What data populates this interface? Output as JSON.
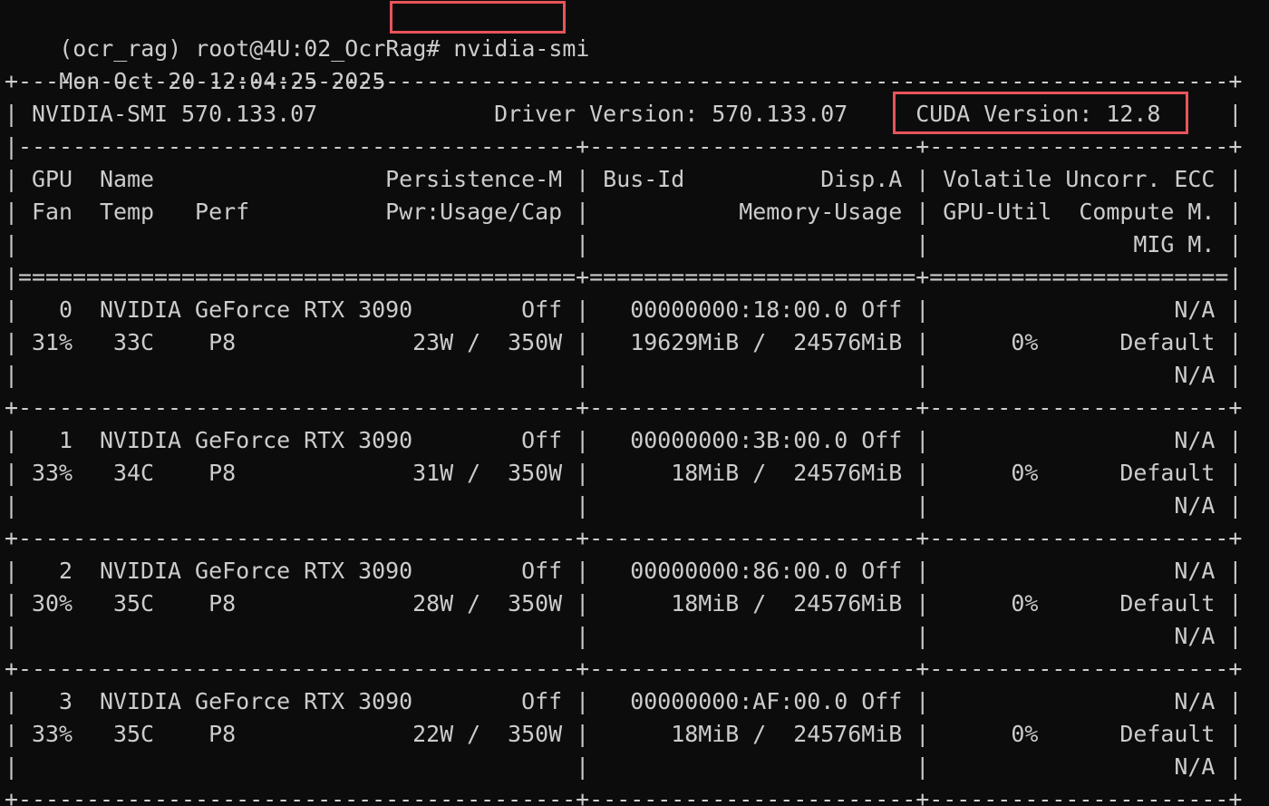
{
  "terminal": {
    "prompt": "(ocr_rag) root@4U:02_OcrRag# ",
    "command": "nvidia-smi",
    "timestamp": "Mon Oct 20 12:04:25 2025"
  },
  "smi": {
    "border_solid": "+-----------------------------------------------------------------------------------------+",
    "header_line": "| NVIDIA-SMI 570.133.07             Driver Version: 570.133.07     CUDA Version: 12.8     |",
    "divider_dashed": "|-----------------------------------------+------------------------+----------------------+",
    "col_header_1": "| GPU  Name                 Persistence-M | Bus-Id          Disp.A | Volatile Uncorr. ECC |",
    "col_header_2": "| Fan  Temp   Perf          Pwr:Usage/Cap |           Memory-Usage | GPU-Util  Compute M. |",
    "col_header_3": "|                                         |                        |               MIG M. |",
    "divider_double": "|=========================================+========================+======================|",
    "row_separator": "+-----------------------------------------+------------------------+----------------------+",
    "gpus": [
      {
        "line1": "|   0  NVIDIA GeForce RTX 3090        Off |   00000000:18:00.0 Off |                  N/A |",
        "line2": "| 31%   33C    P8             23W /  350W |   19629MiB /  24576MiB |      0%      Default |",
        "line3": "|                                         |                        |                  N/A |"
      },
      {
        "line1": "|   1  NVIDIA GeForce RTX 3090        Off |   00000000:3B:00.0 Off |                  N/A |",
        "line2": "| 33%   34C    P8             31W /  350W |      18MiB /  24576MiB |      0%      Default |",
        "line3": "|                                         |                        |                  N/A |"
      },
      {
        "line1": "|   2  NVIDIA GeForce RTX 3090        Off |   00000000:86:00.0 Off |                  N/A |",
        "line2": "| 30%   35C    P8             28W /  350W |      18MiB /  24576MiB |      0%      Default |",
        "line3": "|                                         |                        |                  N/A |"
      },
      {
        "line1": "|   3  NVIDIA GeForce RTX 3090        Off |   00000000:AF:00.0 Off |                  N/A |",
        "line2": "| 33%   35C    P8             22W /  350W |      18MiB /  24576MiB |      0%      Default |",
        "line3": "|                                         |                        |                  N/A |"
      }
    ],
    "border_bottom": "+-----------------------------------------+------------------------+----------------------+"
  },
  "colors": {
    "background": "#0c0c0c",
    "text": "#cccccc",
    "highlight": "#e8545a"
  }
}
